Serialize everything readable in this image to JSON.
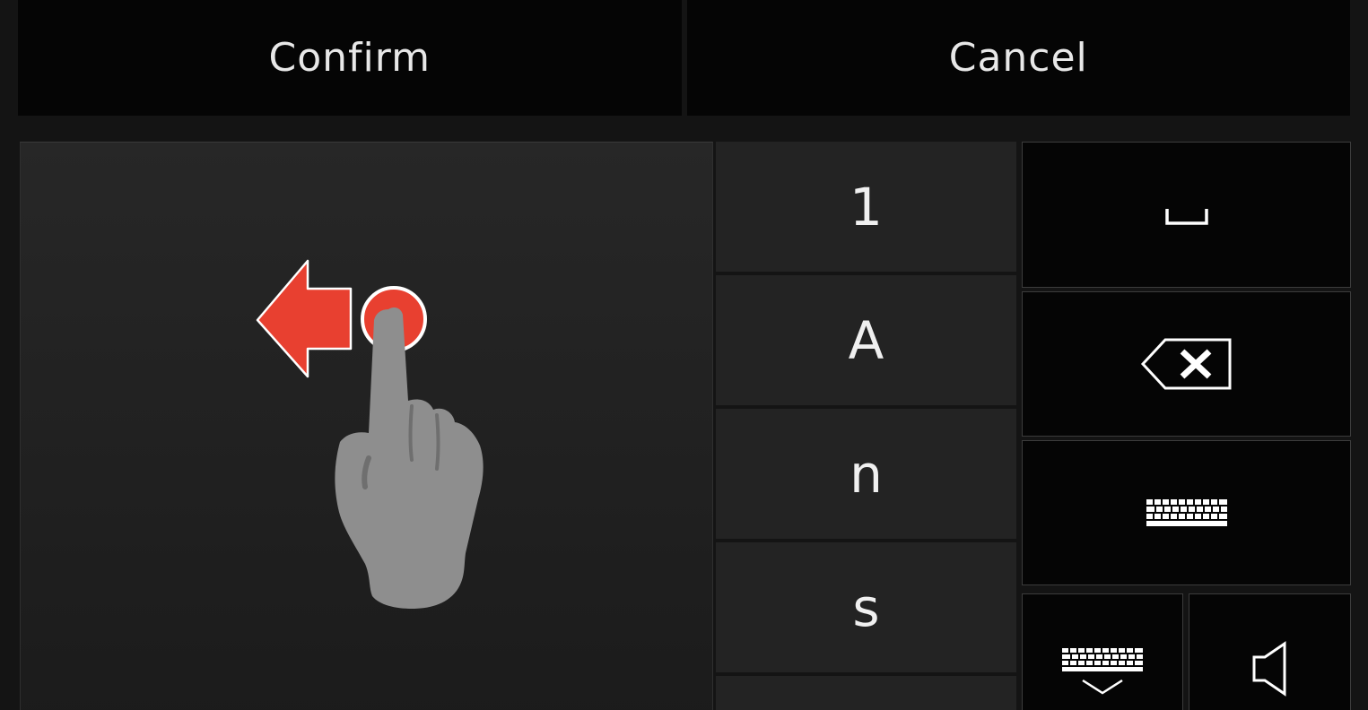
{
  "top_bar": {
    "confirm_label": "Confirm",
    "cancel_label": "Cancel"
  },
  "handwriting_pad": {
    "hint_icon": "swipe-left-gesture-icon",
    "colors": {
      "arrow": "#e84030",
      "finger": "#8e8e8e"
    }
  },
  "candidates": [
    {
      "label": "1"
    },
    {
      "label": "A"
    },
    {
      "label": "n"
    },
    {
      "label": "s"
    },
    {
      "label": ""
    }
  ],
  "function_keys": {
    "space_icon": "space-icon",
    "backspace_icon": "backspace-icon",
    "keyboard_icon": "keyboard-icon",
    "hide_keyboard_icon": "hide-keyboard-icon",
    "sound_icon": "speaker-icon"
  }
}
